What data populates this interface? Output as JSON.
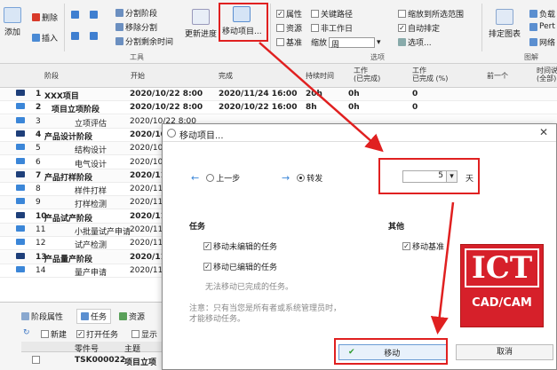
{
  "ribbon": {
    "add": "添加",
    "delete": "删除",
    "insert": "插入",
    "split_phase": "分割阶段",
    "remove_split": "移除分割",
    "split_remaining": "分割剩余时间",
    "update_progress": "更新进度",
    "move_project": "移动项目...",
    "tools_group": "工具",
    "options_group": "选项",
    "chart_group": "图解",
    "opt_attr": "属性",
    "opt_resource": "资源",
    "opt_baseline": "基准",
    "opt_critical": "关键路径",
    "opt_nonworkday": "非工作日",
    "zoom_label": "缩放",
    "zoom_value": "周",
    "opt_zoom_range": "缩放到所选范围",
    "opt_auto_sort": "自动排定",
    "opt_options": "选项...",
    "arrange_chart": "排定图表",
    "right1": "负载",
    "right2": "Pert",
    "right3": "网络"
  },
  "grid": {
    "headers": [
      "阶段",
      "开始",
      "完成",
      "持续时间",
      "工作\n(已完成)",
      "工作\n已完成 (%)",
      "前一个",
      "时间说\n(全部)"
    ],
    "rows": [
      {
        "n": "1",
        "name": "XXX项目",
        "start": "2020/10/22 8:00",
        "end": "2020/11/24 16:00",
        "dur": "20h",
        "work": "0h",
        "pct": "0",
        "bold": true
      },
      {
        "n": "2",
        "name": "项目立项阶段",
        "start": "2020/10/22 8:00",
        "end": "2020/10/22 16:00",
        "dur": "8h",
        "work": "0h",
        "pct": "0",
        "bold": false
      },
      {
        "n": "3",
        "name": "立项评估",
        "start": "2020/10/22 8:00",
        "end": "",
        "dur": "",
        "work": "",
        "pct": "",
        "bold": false
      },
      {
        "n": "4",
        "name": "产品设计阶段",
        "start": "2020/10/22 8:00",
        "end": "",
        "dur": "",
        "work": "",
        "pct": "",
        "bold": true
      },
      {
        "n": "5",
        "name": "结构设计",
        "start": "2020/10/22",
        "end": "",
        "dur": "",
        "work": "",
        "pct": "",
        "bold": false
      },
      {
        "n": "6",
        "name": "电气设计",
        "start": "2020/10/22",
        "end": "",
        "dur": "",
        "work": "",
        "pct": "",
        "bold": false
      },
      {
        "n": "7",
        "name": "产品打样阶段",
        "start": "2020/11/",
        "end": "",
        "dur": "",
        "work": "",
        "pct": "",
        "bold": true
      },
      {
        "n": "8",
        "name": "样件打样",
        "start": "2020/11/",
        "end": "",
        "dur": "",
        "work": "",
        "pct": "",
        "bold": false
      },
      {
        "n": "9",
        "name": "打样检测",
        "start": "2020/11/",
        "end": "",
        "dur": "",
        "work": "",
        "pct": "",
        "bold": false
      },
      {
        "n": "10",
        "name": "产品试产阶段",
        "start": "2020/11/",
        "end": "",
        "dur": "",
        "work": "",
        "pct": "",
        "bold": true
      },
      {
        "n": "11",
        "name": "小批量试产申请",
        "start": "2020/11/",
        "end": "",
        "dur": "",
        "work": "",
        "pct": "",
        "bold": false
      },
      {
        "n": "12",
        "name": "试产检测",
        "start": "2020/11/",
        "end": "",
        "dur": "",
        "work": "",
        "pct": "",
        "bold": false
      },
      {
        "n": "13",
        "name": "产品量产阶段",
        "start": "2020/11/",
        "end": "",
        "dur": "",
        "work": "",
        "pct": "",
        "bold": true
      },
      {
        "n": "14",
        "name": "量产申请",
        "start": "2020/11/",
        "end": "",
        "dur": "",
        "work": "",
        "pct": "",
        "bold": false
      }
    ]
  },
  "bottom": {
    "tab_phase": "阶段属性",
    "tab_task": "任务",
    "tab_resource": "资源",
    "btn_new": "新建",
    "btn_open": "打开任务",
    "btn_show": "显示",
    "col_part": "零件号",
    "col_subject": "主题",
    "row_part": "TSK000022",
    "row_subject": "项目立项"
  },
  "dialog": {
    "title": "移动项目...",
    "prev_step": "上一步",
    "forward": "转发",
    "amount": "5",
    "unit": "天",
    "task_section": "任务",
    "other_section": "其他",
    "move_unedited": "移动未编辑的任务",
    "move_edited": "移动已编辑的任务",
    "no_move_done": "无法移动已完成的任务。",
    "move_baseline": "移动基准",
    "note": "注意：只有当您是所有者或系统管理员时，才能移动任务。",
    "move_btn": "移动",
    "cancel_btn": "取消"
  },
  "logo": {
    "line1": "ICT",
    "line2": "CAD/CAM"
  },
  "colors": {
    "highlight": "#e02020",
    "logo_red": "#d6202a",
    "accent_blue": "#3b86d8"
  }
}
